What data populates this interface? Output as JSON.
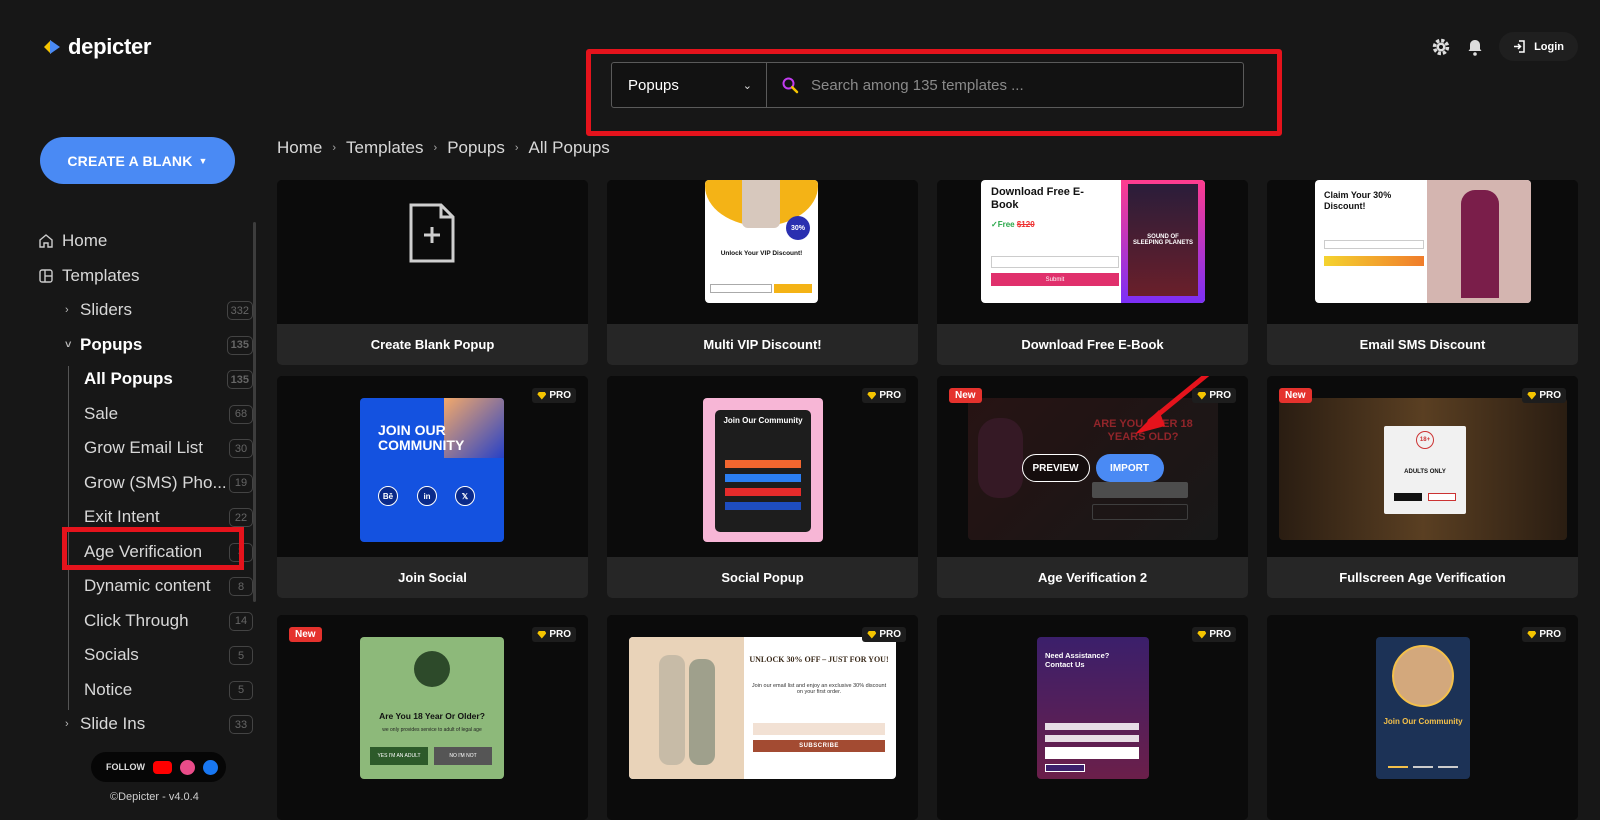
{
  "app": {
    "logo_text": "depicter"
  },
  "search": {
    "category": "Popups",
    "placeholder": "Search among 135 templates ..."
  },
  "header": {
    "login_label": "Login"
  },
  "sidebar": {
    "create_label": "CREATE A BLANK",
    "items": [
      {
        "label": "Home"
      },
      {
        "label": "Templates"
      },
      {
        "label": "Sliders",
        "count": "332"
      },
      {
        "label": "Popups",
        "count": "135"
      },
      {
        "label": "All Popups",
        "count": "135"
      },
      {
        "label": "Sale",
        "count": "68"
      },
      {
        "label": "Grow Email List",
        "count": "30"
      },
      {
        "label": "Grow (SMS) Pho...",
        "count": "19"
      },
      {
        "label": "Exit Intent",
        "count": "22"
      },
      {
        "label": "Age Verification",
        "count": "3"
      },
      {
        "label": "Dynamic content",
        "count": "8"
      },
      {
        "label": "Click Through",
        "count": "14"
      },
      {
        "label": "Socials",
        "count": "5"
      },
      {
        "label": "Notice",
        "count": "5"
      },
      {
        "label": "Slide Ins",
        "count": "33"
      }
    ],
    "follow_label": "FOLLOW",
    "copyright": "©Depicter - v4.0.4"
  },
  "breadcrumb": [
    "Home",
    "Templates",
    "Popups",
    "All Popups"
  ],
  "cards": [
    {
      "title": "Create Blank Popup",
      "pro": "",
      "new": ""
    },
    {
      "title": "Multi VIP Discount!",
      "pro": "",
      "new": "",
      "thumb_heading": "Unlock Your VIP Discount!",
      "thumb_badge": "30%"
    },
    {
      "title": "Download Free E-Book",
      "pro": "",
      "new": "",
      "thumb_heading": "Download Free E-Book",
      "thumb_free": "✓Free",
      "thumb_price": "$120",
      "thumb_button": "Submit",
      "thumb_book": "SOUND OF SLEEPING PLANETS"
    },
    {
      "title": "Email SMS Discount",
      "pro": "",
      "new": "",
      "thumb_heading": "Claim Your 30% Discount!"
    },
    {
      "title": "Join Social",
      "pro": "PRO",
      "new": "",
      "thumb_heading": "JOIN OUR COMMUNITY"
    },
    {
      "title": "Social Popup",
      "pro": "PRO",
      "new": "",
      "thumb_heading": "Join Our Community"
    },
    {
      "title": "Age Verification 2",
      "pro": "PRO",
      "new": "New",
      "thumb_heading": "ARE YOU OVER 18 YEARS OLD?",
      "preview_label": "PREVIEW",
      "import_label": "IMPORT"
    },
    {
      "title": "Fullscreen Age Verification",
      "pro": "PRO",
      "new": "New",
      "thumb_heading": "ADULTS ONLY",
      "thumb_badge": "18+"
    },
    {
      "title": "",
      "pro": "PRO",
      "new": "New",
      "thumb_heading": "Are You 18 Year Or Older?",
      "thumb_sub": "we only provides service to adult of legal age",
      "thumb_yes": "YES I'M AN ADULT",
      "thumb_no": "NO I'M NOT"
    },
    {
      "title": "",
      "pro": "PRO",
      "new": "",
      "thumb_heading": "UNLOCK 30% OFF – JUST FOR YOU!",
      "thumb_sub": "Join our email list and enjoy an exclusive 30% discount on your first order.",
      "thumb_button": "SUBSCRIBE"
    },
    {
      "title": "",
      "pro": "PRO",
      "new": "",
      "thumb_heading": "Need Assistance? Contact Us"
    },
    {
      "title": "",
      "pro": "PRO",
      "new": "",
      "thumb_heading": "Join Our Community"
    }
  ],
  "colors": {
    "accent": "#4a8af4",
    "highlight": "#e5131c",
    "new_badge": "#e5322d",
    "pro_gem": "#f5c400"
  }
}
